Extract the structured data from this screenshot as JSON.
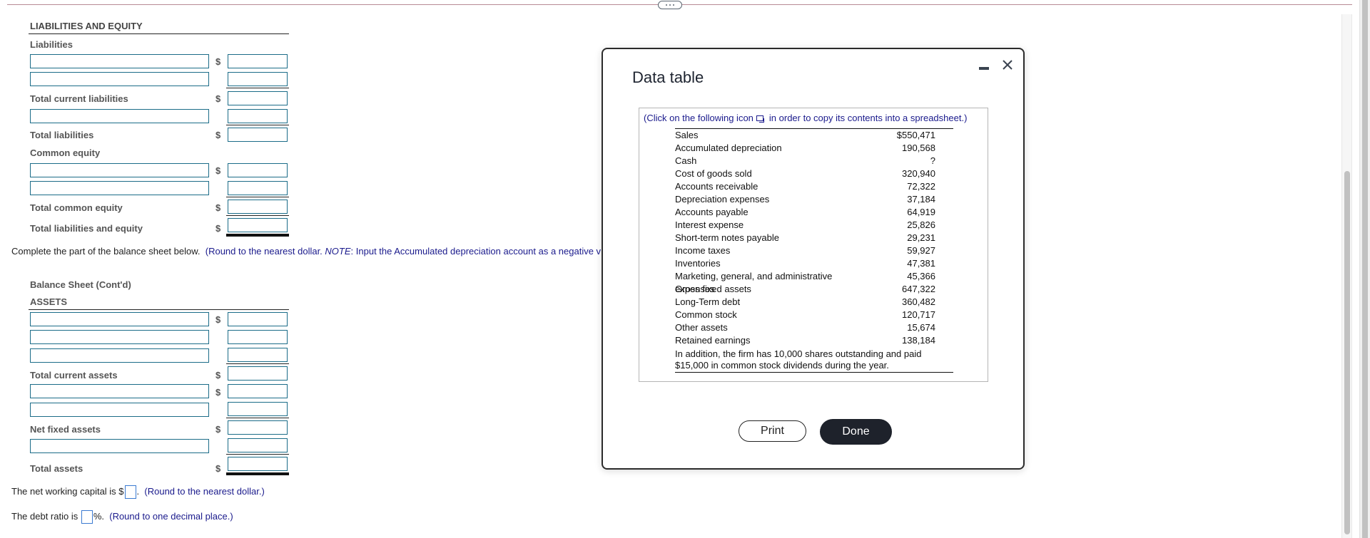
{
  "liabilities_section": {
    "header": "LIABILITIES AND EQUITY",
    "liabilities_label": "Liabilities",
    "total_current_liabilities": "Total current liabilities",
    "total_liabilities": "Total liabilities",
    "common_equity_label": "Common equity",
    "total_common_equity": "Total common equity",
    "total_liabilities_and_equity": "Total liabilities and equity",
    "currency_symbol": "$"
  },
  "instruction": {
    "main": "Complete the part of the balance sheet below.",
    "hint_prefix": "(Round to the nearest dollar. ",
    "hint_note_label": "NOTE",
    "hint_rest": ": Input the Accumulated depreciation  account as a negative v"
  },
  "assets_section": {
    "title": "Balance Sheet (Cont'd)",
    "header": "ASSETS",
    "total_current_assets": "Total current assets",
    "net_fixed_assets": "Net fixed assets",
    "total_assets": "Total assets",
    "currency_symbol": "$"
  },
  "questions": {
    "nwc_prefix": "The net working capital is $",
    "nwc_suffix": ".",
    "nwc_hint": "(Round to the nearest dollar.)",
    "debt_prefix": "The debt ratio is ",
    "debt_suffix": "%.",
    "debt_hint": "(Round to one decimal place.)"
  },
  "dialog": {
    "title": "Data table",
    "copy_note_before": "(Click on the following icon",
    "copy_note_after": "in order to copy its contents into a spreadsheet.)",
    "rows": [
      {
        "label": "Sales",
        "value": "$550,471"
      },
      {
        "label": "Accumulated depreciation",
        "value": "190,568"
      },
      {
        "label": "Cash",
        "value": "?"
      },
      {
        "label": "Cost of goods sold",
        "value": "320,940"
      },
      {
        "label": "Accounts receivable",
        "value": "72,322"
      },
      {
        "label": "Depreciation expenses",
        "value": "37,184"
      },
      {
        "label": "Accounts payable",
        "value": "64,919"
      },
      {
        "label": "Interest expense",
        "value": "25,826"
      },
      {
        "label": "Short-term notes payable",
        "value": "29,231"
      },
      {
        "label": "Income taxes",
        "value": "59,927"
      },
      {
        "label": "Inventories",
        "value": "47,381"
      },
      {
        "label": "Marketing, general, and administrative expenses",
        "value": "45,366"
      },
      {
        "label": "Gross fixed assets",
        "value": "647,322"
      },
      {
        "label": "Long-Term debt",
        "value": "360,482"
      },
      {
        "label": "Common stock",
        "value": "120,717"
      },
      {
        "label": "Other assets",
        "value": "15,674"
      },
      {
        "label": "Retained earnings",
        "value": "138,184"
      }
    ],
    "note": "In addition, the firm has 10,000 shares outstanding and paid $15,000 in common stock dividends during the year.",
    "print_label": "Print",
    "done_label": "Done"
  }
}
